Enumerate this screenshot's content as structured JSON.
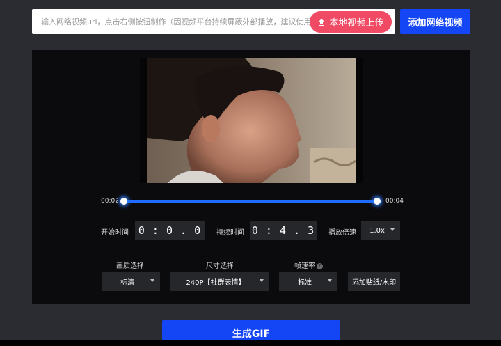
{
  "url_bar": {
    "placeholder": "输入网络视频url，点击右侧按钮制作（因视频平台持续屏蔽外部播放，建议使用本地视频上传）"
  },
  "buttons": {
    "upload_local": "本地视频上传",
    "add_network": "添加网络视频",
    "generate": "生成GIF",
    "add_sticker": "添加贴纸/水印"
  },
  "player": {
    "range_start": "00:02",
    "range_end": "00:04",
    "range_fraction": [
      0.0,
      1.0
    ]
  },
  "controls": {
    "start_label": "开始时间",
    "start_value": "0 : 0 . 0",
    "duration_label": "持续时间",
    "duration_value": "0 : 4 . 3",
    "speed_label": "播放倍速",
    "speed_value": "1.0x"
  },
  "options": {
    "quality_label": "画质选择",
    "quality_value": "标清",
    "size_label": "尺寸选择",
    "size_value": "240P【社群表情】",
    "fps_label": "帧速率",
    "fps_value": "标准"
  },
  "colors": {
    "accent": "#1446f5",
    "upload": "#f04a64",
    "track": "#1f6cff"
  }
}
